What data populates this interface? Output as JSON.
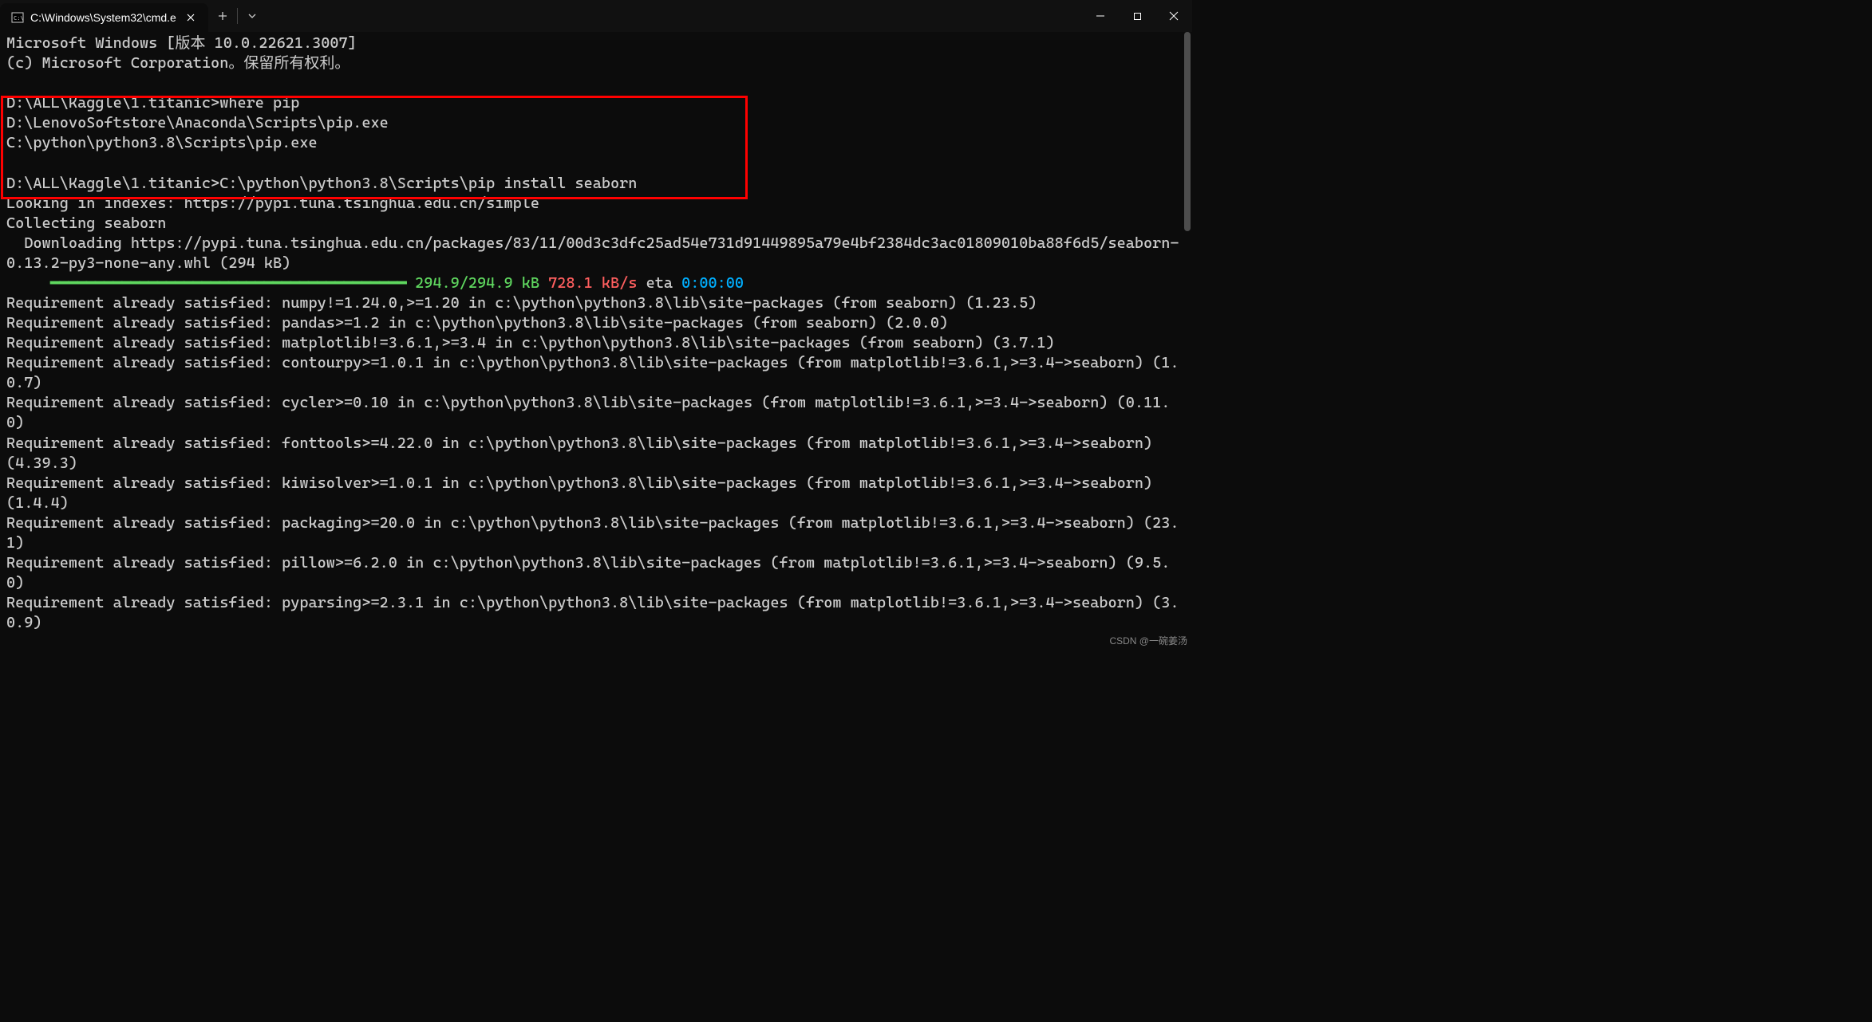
{
  "tab": {
    "title": "C:\\Windows\\System32\\cmd.e"
  },
  "header": {
    "line1": "Microsoft Windows [版本 10.0.22621.3007]",
    "line2": "(c) Microsoft Corporation。保留所有权利。"
  },
  "block1": {
    "prompt1": "D:\\ALL\\Kaggle\\1.titanic>where pip",
    "out1": "D:\\LenovoSoftstore\\Anaconda\\Scripts\\pip.exe",
    "out2": "C:\\python\\python3.8\\Scripts\\pip.exe",
    "blank": "",
    "prompt2": "D:\\ALL\\Kaggle\\1.titanic>C:\\python\\python3.8\\Scripts\\pip install seaborn"
  },
  "pip": {
    "l1": "Looking in indexes: https://pypi.tuna.tsinghua.edu.cn/simple",
    "l2": "Collecting seaborn",
    "l3": "  Downloading https://pypi.tuna.tsinghua.edu.cn/packages/83/11/00d3c3dfc25ad54e731d91449895a79e4bf2384dc3ac01809010ba88f6d5/seaborn-0.13.2-py3-none-any.whl (294 kB)"
  },
  "progress": {
    "bar": "     ━━━━━━━━━━━━━━━━━━━━━━━━━━━━━━━━━━━━━━━━",
    "size": " 294.9/294.9 kB",
    "speed": " 728.1 kB/s",
    "eta_label": " eta ",
    "eta": "0:00:00"
  },
  "reqs": [
    "Requirement already satisfied: numpy!=1.24.0,>=1.20 in c:\\python\\python3.8\\lib\\site-packages (from seaborn) (1.23.5)",
    "Requirement already satisfied: pandas>=1.2 in c:\\python\\python3.8\\lib\\site-packages (from seaborn) (2.0.0)",
    "Requirement already satisfied: matplotlib!=3.6.1,>=3.4 in c:\\python\\python3.8\\lib\\site-packages (from seaborn) (3.7.1)",
    "Requirement already satisfied: contourpy>=1.0.1 in c:\\python\\python3.8\\lib\\site-packages (from matplotlib!=3.6.1,>=3.4->seaborn) (1.0.7)",
    "Requirement already satisfied: cycler>=0.10 in c:\\python\\python3.8\\lib\\site-packages (from matplotlib!=3.6.1,>=3.4->seaborn) (0.11.0)",
    "Requirement already satisfied: fonttools>=4.22.0 in c:\\python\\python3.8\\lib\\site-packages (from matplotlib!=3.6.1,>=3.4->seaborn) (4.39.3)",
    "Requirement already satisfied: kiwisolver>=1.0.1 in c:\\python\\python3.8\\lib\\site-packages (from matplotlib!=3.6.1,>=3.4->seaborn) (1.4.4)",
    "Requirement already satisfied: packaging>=20.0 in c:\\python\\python3.8\\lib\\site-packages (from matplotlib!=3.6.1,>=3.4->seaborn) (23.1)",
    "Requirement already satisfied: pillow>=6.2.0 in c:\\python\\python3.8\\lib\\site-packages (from matplotlib!=3.6.1,>=3.4->seaborn) (9.5.0)",
    "Requirement already satisfied: pyparsing>=2.3.1 in c:\\python\\python3.8\\lib\\site-packages (from matplotlib!=3.6.1,>=3.4->seaborn) (3.0.9)"
  ],
  "watermark": "CSDN @一碗姜汤"
}
